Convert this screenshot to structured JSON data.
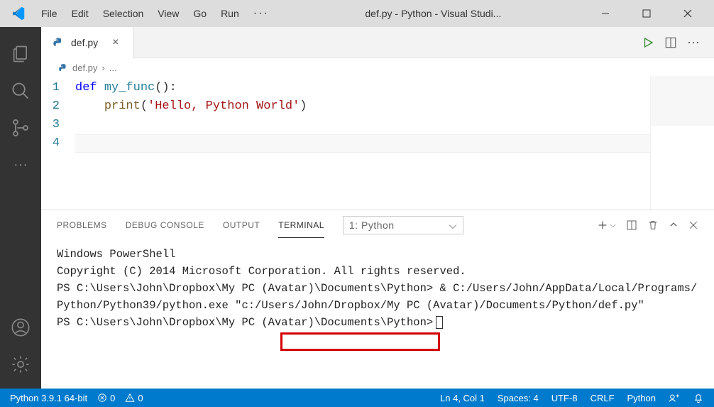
{
  "title": "def.py - Python - Visual Studi...",
  "menu": [
    "File",
    "Edit",
    "Selection",
    "View",
    "Go",
    "Run"
  ],
  "tab": {
    "filename": "def.py"
  },
  "breadcrumb": {
    "file": "def.py",
    "more": "..."
  },
  "code": {
    "line1": {
      "kw": "def",
      "space1": " ",
      "fn": "my_func",
      "parens": "():"
    },
    "line2": {
      "indent": "    ",
      "call": "print",
      "open": "(",
      "str": "'Hello, Python World'",
      "close": ")"
    },
    "line_numbers": [
      "1",
      "2",
      "3",
      "4"
    ]
  },
  "panel": {
    "tabs": [
      "PROBLEMS",
      "DEBUG CONSOLE",
      "OUTPUT",
      "TERMINAL"
    ],
    "active_tab": "TERMINAL",
    "select_label": "1: Python"
  },
  "terminal": {
    "line1": "Windows PowerShell",
    "line2": "Copyright (C) 2014 Microsoft Corporation. All rights reserved.",
    "line3": "",
    "line4": "PS C:\\Users\\John\\Dropbox\\My PC (Avatar)\\Documents\\Python> & C:/Users/John/AppData/Local/Programs/Python/Python39/python.exe \"c:/Users/John/Dropbox/My PC (Avatar)/Documents/Python/def.py\"",
    "line5": "PS C:\\Users\\John\\Dropbox\\My PC (Avatar)\\Documents\\Python>"
  },
  "status": {
    "python": "Python 3.9.1 64-bit",
    "errors": "0",
    "warnings": "0",
    "position": "Ln 4, Col 1",
    "spaces": "Spaces: 4",
    "encoding": "UTF-8",
    "eol": "CRLF",
    "lang": "Python"
  }
}
